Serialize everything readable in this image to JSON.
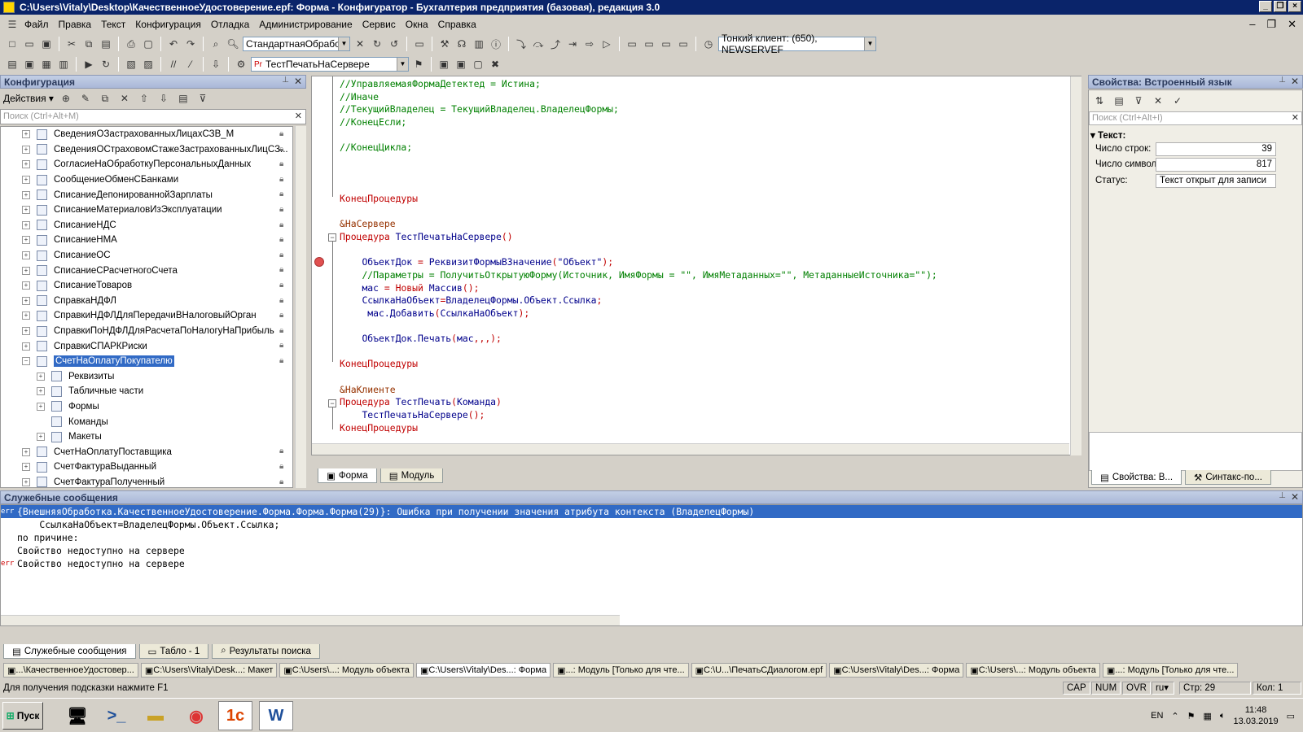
{
  "title": "C:\\Users\\Vitaly\\Desktop\\КачественноеУдостоверение.epf: Форма - Конфигуратор - Бухгалтерия предприятия (базовая), редакция 3.0",
  "menu": [
    "Файл",
    "Правка",
    "Текст",
    "Конфигурация",
    "Отладка",
    "Администрирование",
    "Сервис",
    "Окна",
    "Справка"
  ],
  "toolbar": {
    "combo1": "СтандартнаяОбработк",
    "combo2": "Тонкий клиент: (650), NEWSERVEF",
    "combo3": "ТестПечатьНаСервере"
  },
  "config_panel": {
    "title": "Конфигурация",
    "actions": "Действия",
    "search_placeholder": "Поиск (Ctrl+Alt+M)"
  },
  "tree": [
    "СведенияОЗастрахованныхЛицахСЗВ_М",
    "СведенияОСтраховомСтажеЗастрахованныхЛицСЗ...",
    "СогласиеНаОбработкуПерсональныхДанных",
    "СообщениеОбменСБанками",
    "СписаниеДепонированнойЗарплаты",
    "СписаниеМатериаловИзЭксплуатации",
    "СписаниеНДС",
    "СписаниеНМА",
    "СписаниеОС",
    "СписаниеСРасчетногоСчета",
    "СписаниеТоваров",
    "СправкаНДФЛ",
    "СправкиНДФЛДляПередачиВНалоговыйОрган",
    "СправкиПоНДФЛДляРасчетаПоНалогуНаПрибыль",
    "СправкиСПАРКРиски",
    "СчетНаОплатуПокупателю"
  ],
  "tree_children": [
    "Реквизиты",
    "Табличные части",
    "Формы",
    "Команды",
    "Макеты"
  ],
  "tree_after": [
    "СчетНаОплатуПоставщика",
    "СчетФактураВыданный",
    "СчетФактураПолученный"
  ],
  "editor_tabs": [
    "Форма",
    "Модуль"
  ],
  "props": {
    "title": "Свойства: Встроенный язык",
    "search_placeholder": "Поиск (Ctrl+Alt+I)",
    "group": "Текст:",
    "rows_label": "Число строк:",
    "rows_value": "39",
    "chars_label": "Число символ",
    "chars_value": "817",
    "status_label": "Статус:",
    "status_value": "Текст открыт для записи",
    "tab1": "Свойства: В...",
    "tab2": "Синтакс-по..."
  },
  "messages": {
    "title": "Служебные сообщения",
    "lines": [
      "{ВнешняяОбработка.КачественноеУдостоверение.Форма.Форма.Форма(29)}: Ошибка при получении значения атрибута контекста (ВладелецФормы)",
      "    СсылкаНаОбъект=ВладелецФормы.Объект.Ссылка;",
      "по причине:",
      "Свойство недоступно на сервере",
      "Свойство недоступно на сервере"
    ],
    "err": "err"
  },
  "bottom_tabs": [
    "Служебные сообщения",
    "Табло - 1",
    "Результаты поиска"
  ],
  "window_tabs": [
    "...\\КачественноеУдостовер...",
    "C:\\Users\\Vitaly\\Desk...: Макет",
    "C:\\Users\\...: Модуль объекта",
    "C:\\Users\\Vitaly\\Des...: Форма",
    "...: Модуль [Только для чте...",
    "C:\\U...\\ПечатьСДиалогом.epf",
    "C:\\Users\\Vitaly\\Des...: Форма",
    "C:\\Users\\...: Модуль объекта",
    "...: Модуль [Только для чте..."
  ],
  "status": {
    "hint": "Для получения подсказки нажмите F1",
    "cap": "CAP",
    "num": "NUM",
    "ovr": "OVR",
    "lang": "ru",
    "line": "Стр: 29",
    "col": "Кол: 1"
  },
  "taskbar": {
    "start": "Пуск",
    "lang": "EN",
    "time": "11:48",
    "date": "13.03.2019"
  }
}
